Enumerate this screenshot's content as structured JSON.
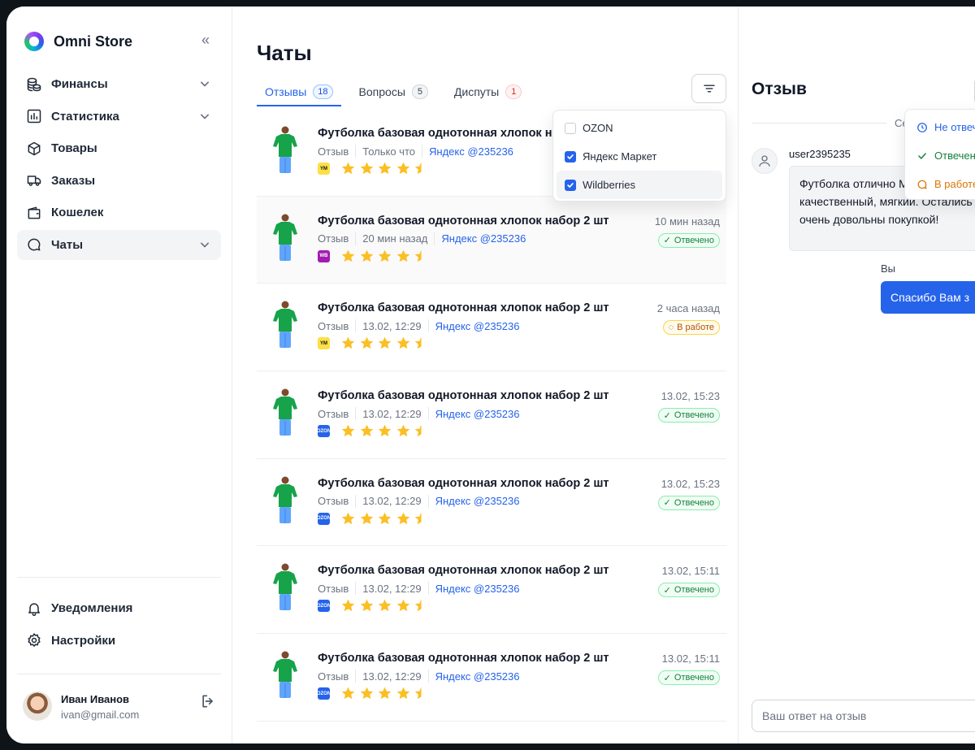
{
  "app": {
    "name": "Omni Store"
  },
  "sidebar": {
    "items": [
      {
        "label": "Финансы",
        "icon": "coins-icon",
        "has_chevron": true
      },
      {
        "label": "Статистика",
        "icon": "chart-icon",
        "has_chevron": true
      },
      {
        "label": "Товары",
        "icon": "box-icon",
        "has_chevron": false
      },
      {
        "label": "Заказы",
        "icon": "truck-icon",
        "has_chevron": false
      },
      {
        "label": "Кошелек",
        "icon": "wallet-icon",
        "has_chevron": false
      },
      {
        "label": "Чаты",
        "icon": "chat-icon",
        "has_chevron": true,
        "active": true
      }
    ],
    "bottom": [
      {
        "label": "Уведомления",
        "icon": "bell-icon"
      },
      {
        "label": "Настройки",
        "icon": "gear-icon"
      }
    ],
    "user": {
      "name": "Иван Иванов",
      "email": "ivan@gmail.com"
    }
  },
  "main": {
    "title": "Чаты",
    "tabs": [
      {
        "label": "Отзывы",
        "count": "18"
      },
      {
        "label": "Вопросы",
        "count": "5"
      },
      {
        "label": "Диспуты",
        "count": "1"
      }
    ],
    "filter": {
      "options": [
        {
          "label": "OZON",
          "checked": false
        },
        {
          "label": "Яндекс Маркет",
          "checked": true
        },
        {
          "label": "Wildberries",
          "checked": true
        }
      ]
    },
    "rows": [
      {
        "title": "Футболка базовая однотонная хлопок на",
        "type": "Отзыв",
        "time_meta": "Только что",
        "link": "Яндекс @235236",
        "mp": "ym",
        "mp_label": "YM",
        "rating": 4.5,
        "time": "",
        "status": "",
        "status_kind": ""
      },
      {
        "title": "Футболка базовая однотонная хлопок набор 2 шт",
        "type": "Отзыв",
        "time_meta": "20 мин назад",
        "link": "Яндекс @235236",
        "mp": "wb",
        "mp_label": "WB",
        "rating": 4.5,
        "time": "10 мин назад",
        "status": "Отвечено",
        "status_kind": "ok"
      },
      {
        "title": "Футболка базовая однотонная хлопок набор 2 шт",
        "type": "Отзыв",
        "time_meta": "13.02, 12:29",
        "link": "Яндекс @235236",
        "mp": "ym",
        "mp_label": "YM",
        "rating": 4.5,
        "time": "2 часа назад",
        "status": "В работе",
        "status_kind": "work"
      },
      {
        "title": "Футболка базовая однотонная хлопок набор 2 шт",
        "type": "Отзыв",
        "time_meta": "13.02, 12:29",
        "link": "Яндекс @235236",
        "mp": "oz",
        "mp_label": "OZON",
        "rating": 4.5,
        "time": "13.02, 15:23",
        "status": "Отвечено",
        "status_kind": "ok"
      },
      {
        "title": "Футболка базовая однотонная хлопок набор 2 шт",
        "type": "Отзыв",
        "time_meta": "13.02, 12:29",
        "link": "Яндекс @235236",
        "mp": "oz",
        "mp_label": "OZON",
        "rating": 4.5,
        "time": "13.02, 15:23",
        "status": "Отвечено",
        "status_kind": "ok"
      },
      {
        "title": "Футболка базовая однотонная хлопок набор 2 шт",
        "type": "Отзыв",
        "time_meta": "13.02, 12:29",
        "link": "Яндекс @235236",
        "mp": "oz",
        "mp_label": "OZON",
        "rating": 4.5,
        "time": "13.02, 15:11",
        "status": "Отвечено",
        "status_kind": "ok"
      },
      {
        "title": "Футболка базовая однотонная хлопок набор 2 шт",
        "type": "Отзыв",
        "time_meta": "13.02, 12:29",
        "link": "Яндекс @235236",
        "mp": "oz",
        "mp_label": "OZON",
        "rating": 4.5,
        "time": "13.02, 15:11",
        "status": "Отвечено",
        "status_kind": "ok"
      }
    ]
  },
  "detail": {
    "title": "Отзыв",
    "date_label": "Се",
    "user": "user2395235",
    "message": "Футболка отлично Материал качественный, мягкий. Остались очень довольны покупкой!",
    "you_label": "Вы",
    "reply_preview": "Спасибо Вам з",
    "status_options": [
      {
        "label": "Не отвеч",
        "color": "#2563eb",
        "icon": "clock-icon"
      },
      {
        "label": "Отвечен",
        "color": "#15803d",
        "icon": "check-icon"
      },
      {
        "label": "В работе",
        "color": "#d97706",
        "icon": "message-icon"
      }
    ],
    "reply_placeholder": "Ваш ответ на отзыв"
  },
  "colors": {
    "accent": "#2563eb",
    "star": "#fbbf24",
    "ok": "#15803d",
    "work": "#b45309"
  }
}
